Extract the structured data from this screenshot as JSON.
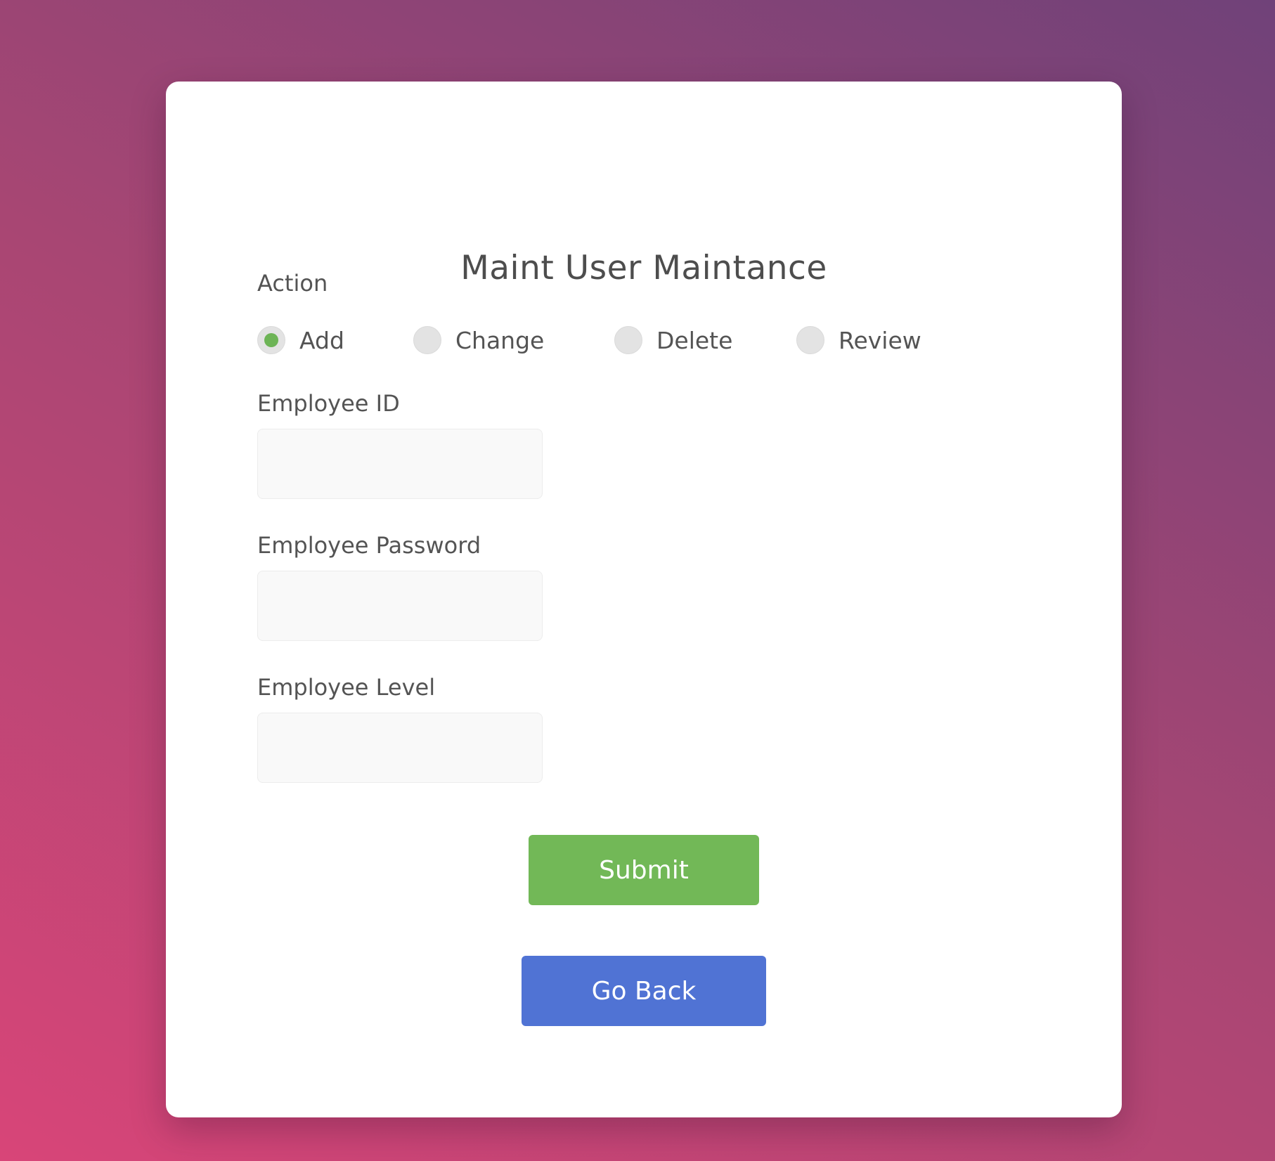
{
  "form": {
    "title": "Maint User Maintance",
    "action_label": "Action",
    "action_options": [
      {
        "label": "Add",
        "checked": true
      },
      {
        "label": "Change",
        "checked": false
      },
      {
        "label": "Delete",
        "checked": false
      },
      {
        "label": "Review",
        "checked": false
      }
    ],
    "employee_id_label": "Employee ID",
    "employee_id_value": "",
    "employee_password_label": "Employee Password",
    "employee_password_value": "",
    "employee_level_label": "Employee Level",
    "employee_level_value": "",
    "submit_label": "Submit",
    "go_back_label": "Go Back"
  },
  "colors": {
    "background_start": "#d84578",
    "background_end": "#704279",
    "card": "#ffffff",
    "radio_selected": "#6db456",
    "submit_button": "#72b857",
    "go_back_button": "#5073d4",
    "text": "#545454"
  }
}
